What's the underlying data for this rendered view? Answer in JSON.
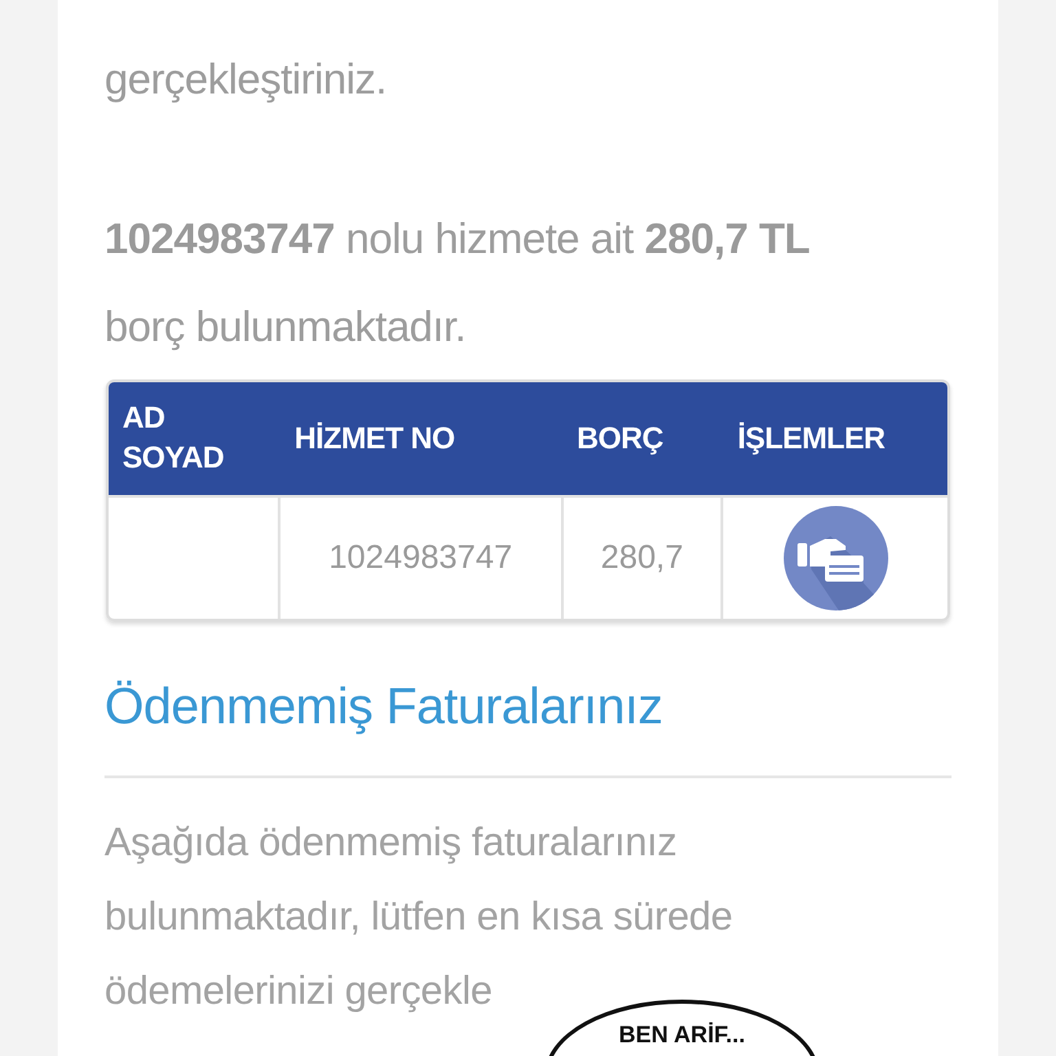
{
  "intro": {
    "lines": [
      "gerçekleştiriniz."
    ]
  },
  "debt_notice": "**1024983747** nolu hizmete ait **280,7 TL** borç bulunmaktadır.",
  "table": {
    "columns": [
      "AD SOYAD",
      "HİZMET NO",
      "BORÇ",
      "İŞLEMLER"
    ],
    "rows": [
      {
        "name": "",
        "service_no": "1024983747",
        "debt": "280,7"
      }
    ]
  },
  "unpaid": {
    "title": "Ödenmemiş Faturalarınız",
    "text": "Aşağıda ödenmemiş faturalarınız bulunmaktadır, lütfen en kısa sürede ödemelerinizi gerçekle"
  },
  "speech_bubble": "BEN ARİF..."
}
